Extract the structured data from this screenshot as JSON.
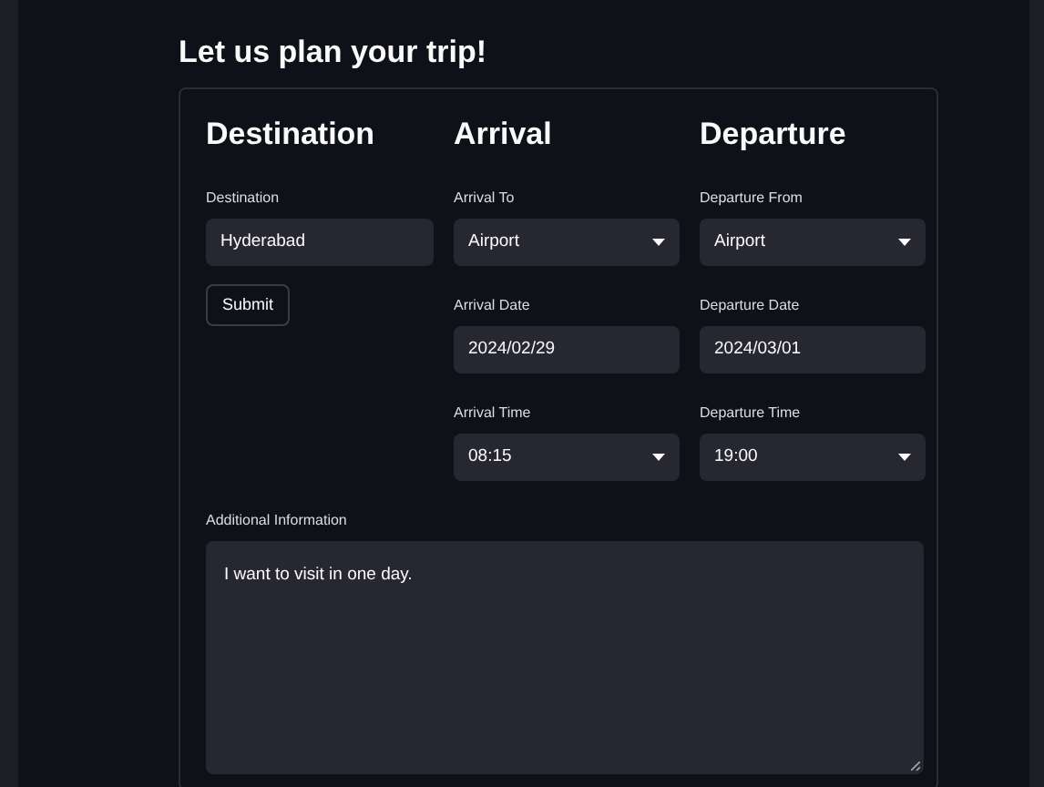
{
  "title": "Let us plan your trip!",
  "columns": [
    {
      "heading": "Destination",
      "fields": [
        {
          "kind": "text",
          "label": "Destination",
          "value": "Hyderabad"
        }
      ],
      "button": "Submit"
    },
    {
      "heading": "Arrival",
      "fields": [
        {
          "kind": "select",
          "label": "Arrival To",
          "value": "Airport"
        },
        {
          "kind": "text",
          "label": "Arrival Date",
          "value": "2024/02/29"
        },
        {
          "kind": "select",
          "label": "Arrival Time",
          "value": "08:15"
        }
      ]
    },
    {
      "heading": "Departure",
      "fields": [
        {
          "kind": "select",
          "label": "Departure From",
          "value": "Airport"
        },
        {
          "kind": "text",
          "label": "Departure Date",
          "value": "2024/03/01"
        },
        {
          "kind": "select",
          "label": "Departure Time",
          "value": "19:00"
        }
      ]
    }
  ],
  "additional": {
    "label": "Additional Information",
    "value": "I want to visit in one day."
  }
}
